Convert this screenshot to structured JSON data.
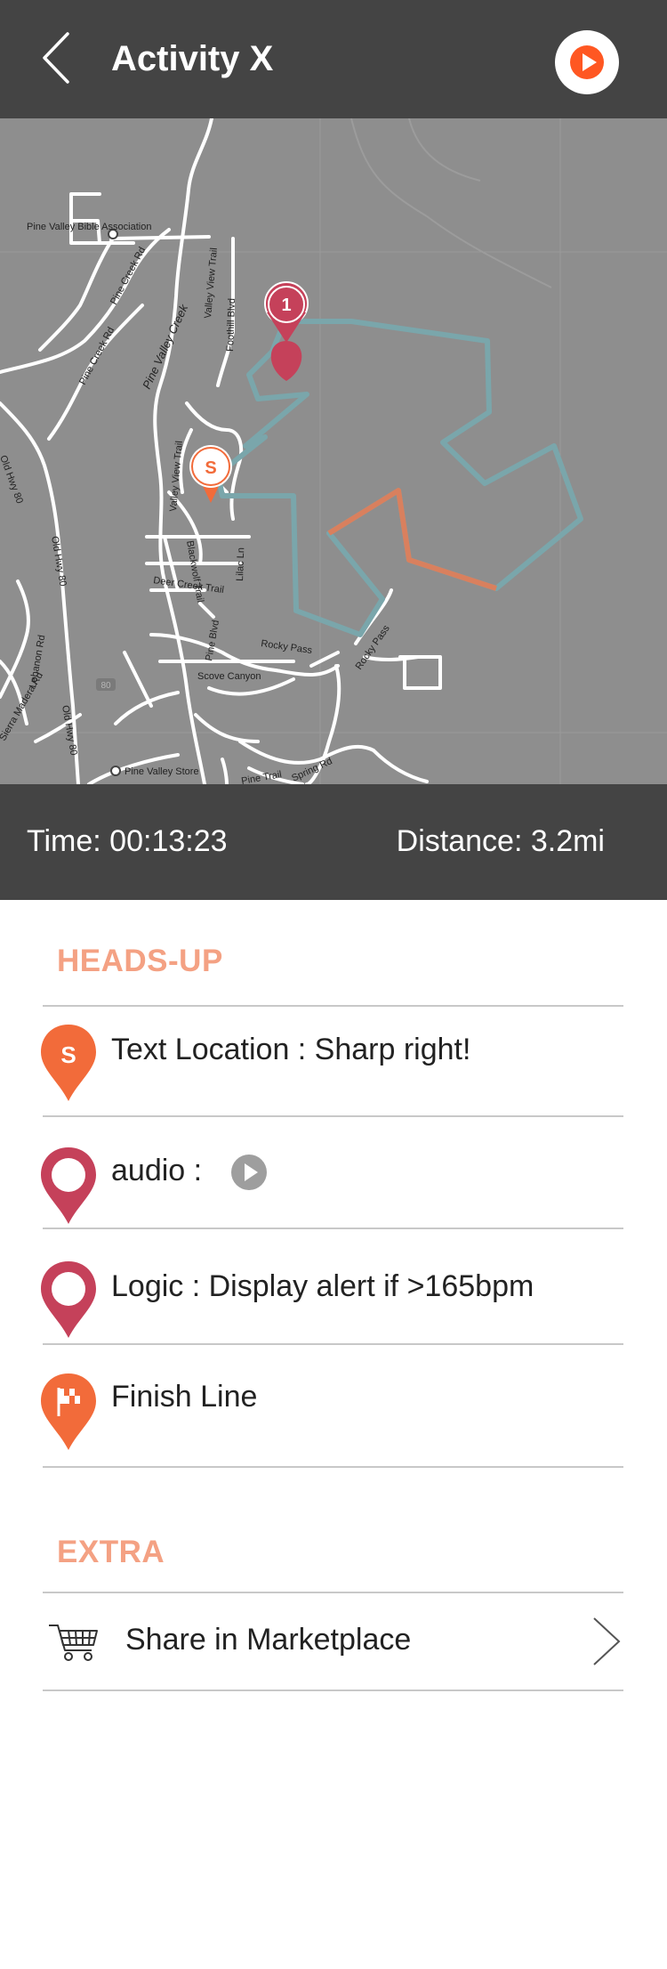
{
  "header": {
    "title": "Activity X",
    "back_icon": "chevron-left-icon",
    "play_icon": "play-icon",
    "accent": "#ff5722"
  },
  "map": {
    "labels": {
      "church": "Pine Valley Bible Association",
      "pine_creek_rd": "Pine Creek Rd",
      "pine_creek_rd2": "Pine Creek Rd",
      "pine_valley_creek": "Pine Valley Creek",
      "valley_view_trail": "Valley View Trail",
      "valley_view_trail2": "Valley View Trail",
      "foothill": "Foothill Blvd",
      "old_hwy_80": "Old Hwy 80",
      "old_hwy_80_2": "Old Hwy 80",
      "old_hwy_80_3": "Old Hwy 80",
      "deer_creek": "Deer Creek Trail",
      "lilac": "Lilac Ln",
      "rocky_pass": "Rocky Pass",
      "rocky_pass2": "Rocky Pass",
      "scove": "Scove Canyon",
      "pine_blvd": "Pine Blvd",
      "lebanon": "Lebanon Rd",
      "sierra_madera": "Sierra Madera Rd",
      "store": "Pine Valley Store",
      "pine_trail": "Pine Trail",
      "spring": "Spring Rd",
      "blackwolf": "Blackwolf Trail",
      "shield": "80"
    },
    "markers": {
      "start": "S",
      "checkpoint": "1"
    },
    "route_color": "#7aa6ab",
    "highlight_color": "#d9805e"
  },
  "stats": {
    "time": "Time: 00:13:23",
    "distance": "Distance: 3.2mi"
  },
  "headsup": {
    "title": "HEADS-UP",
    "items": [
      {
        "pin_text": "S",
        "label": "Text Location : Sharp right!",
        "color": "#f26b3a"
      },
      {
        "label": "audio :",
        "color": "#c5415a"
      },
      {
        "label": "Logic : Display alert if >165bpm",
        "color": "#c5415a"
      },
      {
        "label": "Finish Line",
        "color": "#f26b3a"
      }
    ]
  },
  "extra": {
    "title": "EXTRA",
    "share_label": "Share in Marketplace"
  }
}
